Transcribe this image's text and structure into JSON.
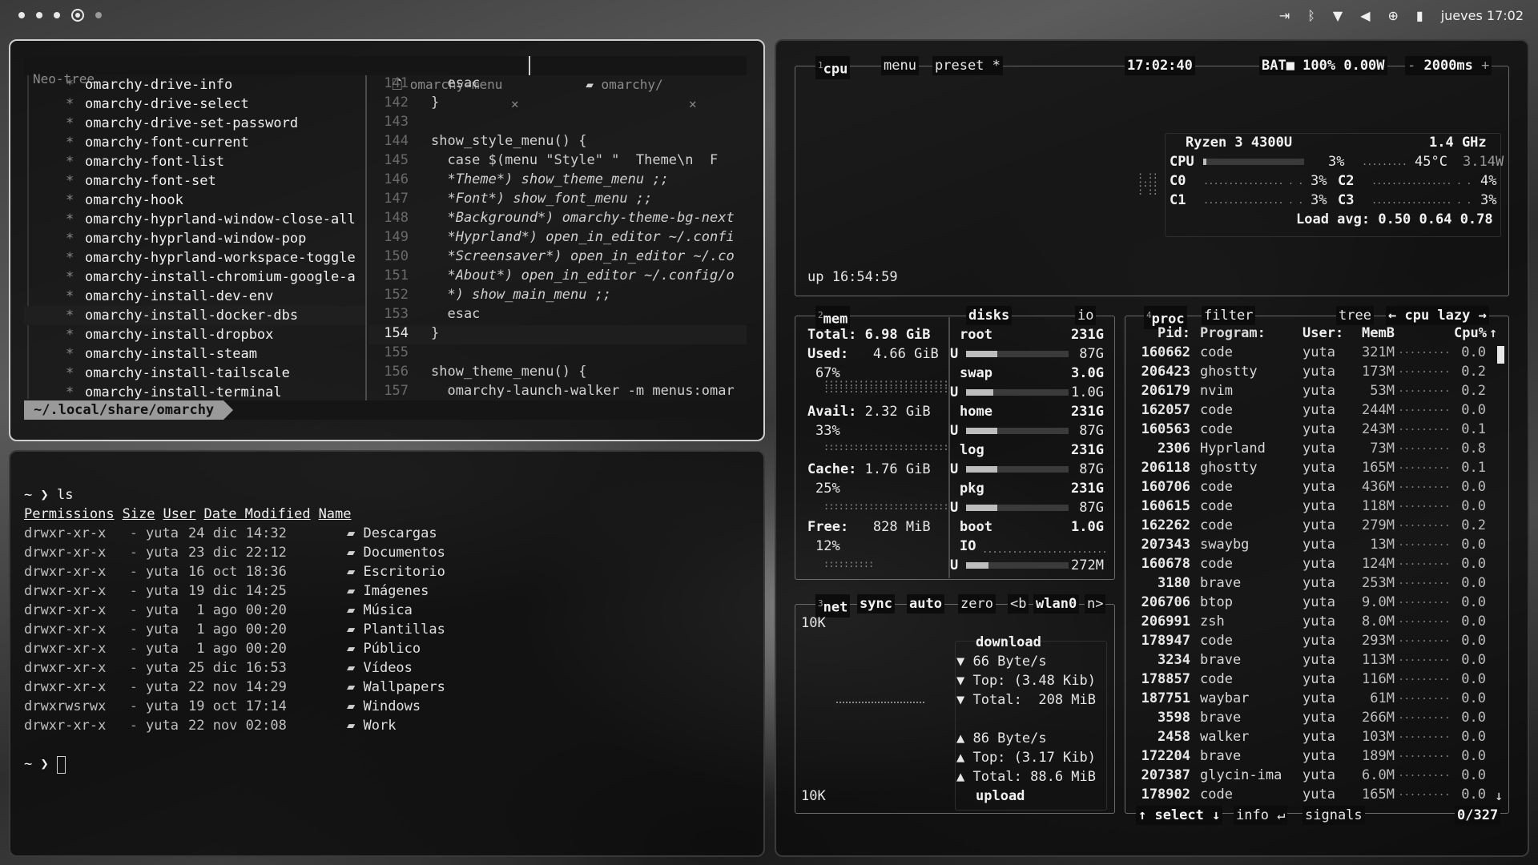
{
  "topbar": {
    "clock": "jueves 17:02",
    "workspaces": [
      "1",
      "2",
      "3",
      "4",
      "5"
    ],
    "active_workspace": 3
  },
  "nvim": {
    "tree_title": "Neo-tree",
    "tabs": [
      {
        "icon": "file-icon",
        "label": "omarchy-menu"
      },
      {
        "icon": "folder-icon",
        "label": "omarchy/"
      }
    ],
    "tree": [
      "omarchy-drive-info",
      "omarchy-drive-select",
      "omarchy-drive-set-password",
      "omarchy-font-current",
      "omarchy-font-list",
      "omarchy-font-set",
      "omarchy-hook",
      "omarchy-hyprland-window-close-all",
      "omarchy-hyprland-window-pop",
      "omarchy-hyprland-workspace-toggle",
      "omarchy-install-chromium-google-a",
      "omarchy-install-dev-env",
      "omarchy-install-docker-dbs",
      "omarchy-install-dropbox",
      "omarchy-install-steam",
      "omarchy-install-tailscale",
      "omarchy-install-terminal"
    ],
    "tree_selected": 12,
    "code": [
      {
        "ln": "141",
        "text": "  esac"
      },
      {
        "ln": "142",
        "text": "}"
      },
      {
        "ln": "143",
        "text": ""
      },
      {
        "ln": "144",
        "text": "show_style_menu() {"
      },
      {
        "ln": "145",
        "text": "  case $(menu \"Style\" \"  Theme\\n  F"
      },
      {
        "ln": "146",
        "text": "  *Theme*) show_theme_menu ;;"
      },
      {
        "ln": "147",
        "text": "  *Font*) show_font_menu ;;"
      },
      {
        "ln": "148",
        "text": "  *Background*) omarchy-theme-bg-next"
      },
      {
        "ln": "149",
        "text": "  *Hyprland*) open_in_editor ~/.confi"
      },
      {
        "ln": "150",
        "text": "  *Screensaver*) open_in_editor ~/.co"
      },
      {
        "ln": "151",
        "text": "  *About*) open_in_editor ~/.config/o"
      },
      {
        "ln": "152",
        "text": "  *) show_main_menu ;;"
      },
      {
        "ln": "153",
        "text": "  esac"
      },
      {
        "ln": "154",
        "text": "}"
      },
      {
        "ln": "155",
        "text": ""
      },
      {
        "ln": "156",
        "text": "show_theme_menu() {"
      },
      {
        "ln": "157",
        "text": "  omarchy-launch-walker -m menus:omar"
      }
    ],
    "current_line": 13,
    "path": "~/.local/share/omarchy"
  },
  "terminal": {
    "prompt": "~ ❯",
    "command": "ls",
    "headers": [
      "Permissions",
      "Size",
      "User",
      "Date Modified",
      "Name"
    ],
    "rows": [
      {
        "perm": "drwxr-xr-x",
        "size": "-",
        "user": "yuta",
        "date": "24 dic 14:32",
        "name": "Descargas"
      },
      {
        "perm": "drwxr-xr-x",
        "size": "-",
        "user": "yuta",
        "date": "23 dic 22:12",
        "name": "Documentos"
      },
      {
        "perm": "drwxr-xr-x",
        "size": "-",
        "user": "yuta",
        "date": "16 oct 18:36",
        "name": "Escritorio"
      },
      {
        "perm": "drwxr-xr-x",
        "size": "-",
        "user": "yuta",
        "date": "19 dic 14:25",
        "name": "Imágenes"
      },
      {
        "perm": "drwxr-xr-x",
        "size": "-",
        "user": "yuta",
        "date": " 1 ago 00:20",
        "name": "Música"
      },
      {
        "perm": "drwxr-xr-x",
        "size": "-",
        "user": "yuta",
        "date": " 1 ago 00:20",
        "name": "Plantillas"
      },
      {
        "perm": "drwxr-xr-x",
        "size": "-",
        "user": "yuta",
        "date": " 1 ago 00:20",
        "name": "Público"
      },
      {
        "perm": "drwxr-xr-x",
        "size": "-",
        "user": "yuta",
        "date": "25 dic 16:53",
        "name": "Vídeos"
      },
      {
        "perm": "drwxr-xr-x",
        "size": "-",
        "user": "yuta",
        "date": "22 nov 14:29",
        "name": "Wallpapers"
      },
      {
        "perm": "drwxrwsrwx",
        "size": "-",
        "user": "yuta",
        "date": "19 oct 17:14",
        "name": "Windows"
      },
      {
        "perm": "drwxr-xr-x",
        "size": "-",
        "user": "yuta",
        "date": "22 nov 02:08",
        "name": "Work"
      }
    ]
  },
  "btop": {
    "cpu_box": {
      "num": "1",
      "title": "cpu",
      "menu": "menu",
      "preset": "preset *",
      "time": "17:02:40",
      "battery": "BAT■ 100% 0.00W",
      "interval": "2000ms"
    },
    "cpu_info": {
      "model": "Ryzen 3 4300U",
      "freq": "1.4 GHz",
      "cpu_label": "CPU",
      "cpu_pct": "3%",
      "cpu_pct_val": 3,
      "temp": "45°C",
      "power": "3.14W",
      "cores": [
        {
          "label": "C0",
          "pct": "3%"
        },
        {
          "label": "C2",
          "pct": "4%"
        },
        {
          "label": "C1",
          "pct": "3%"
        },
        {
          "label": "C3",
          "pct": "3%"
        }
      ],
      "load_avg": "Load avg: 0.50 0.64 0.78"
    },
    "uptime": "up 16:54:59",
    "mem": {
      "num": "2",
      "title": "mem",
      "disks_title": "disks",
      "io_title": "io",
      "total": "Total: 6.98 GiB",
      "used_label": "Used:",
      "used": "4.66 GiB",
      "used_pct": "67%",
      "avail_label": "Avail:",
      "avail": "2.32 GiB",
      "avail_pct": "33%",
      "cache_label": "Cache:",
      "cache": "1.76 GiB",
      "cache_pct": "25%",
      "free_label": "Free:",
      "free": "828 MiB",
      "free_pct": "12%"
    },
    "disks": [
      {
        "name": "root",
        "size": "231G",
        "used": "87G",
        "fill": 0.38
      },
      {
        "name": "swap",
        "size": "3.0G",
        "used": "1.0G",
        "fill": 0.33
      },
      {
        "name": "home",
        "size": "231G",
        "used": "87G",
        "fill": 0.38
      },
      {
        "name": "log",
        "size": "231G",
        "used": "87G",
        "fill": 0.38
      },
      {
        "name": "pkg",
        "size": "231G",
        "used": "87G",
        "fill": 0.38
      },
      {
        "name": "boot",
        "size": "1.0G",
        "used": "272M",
        "fill": 0.27
      }
    ],
    "disk_io_label": "IO",
    "net": {
      "num": "3",
      "title": "net",
      "sync": "sync",
      "auto": "auto",
      "zero": "zero",
      "iface_prev": "<b",
      "iface": "wlan0",
      "iface_next": "n>",
      "scale_top": "10K",
      "scale_bottom": "10K",
      "download": "download",
      "dl_rate": "▼ 66 Byte/s",
      "dl_top": "▼ Top: (3.48 Kib)",
      "dl_total": "▼ Total:  208 MiB",
      "ul_rate": "▲ 86 Byte/s",
      "ul_top": "▲ Top: (3.17 Kib)",
      "ul_total": "▲ Total: 88.6 MiB",
      "upload": "upload"
    },
    "proc": {
      "num": "4",
      "title": "proc",
      "filter": "filter",
      "tree": "tree",
      "sort": "← cpu lazy →",
      "headers": {
        "pid": "Pid:",
        "program": "Program:",
        "user": "User:",
        "mem": "MemB",
        "cpu": "Cpu%"
      },
      "rows": [
        {
          "pid": "160662",
          "program": "code",
          "user": "yuta",
          "mem": "321M",
          "cpu": "0.0"
        },
        {
          "pid": "206423",
          "program": "ghostty",
          "user": "yuta",
          "mem": "173M",
          "cpu": "0.2"
        },
        {
          "pid": "206179",
          "program": "nvim",
          "user": "yuta",
          "mem": "53M",
          "cpu": "0.2"
        },
        {
          "pid": "162057",
          "program": "code",
          "user": "yuta",
          "mem": "244M",
          "cpu": "0.0"
        },
        {
          "pid": "160563",
          "program": "code",
          "user": "yuta",
          "mem": "243M",
          "cpu": "0.1"
        },
        {
          "pid": "2306",
          "program": "Hyprland",
          "user": "yuta",
          "mem": "73M",
          "cpu": "0.8"
        },
        {
          "pid": "206118",
          "program": "ghostty",
          "user": "yuta",
          "mem": "165M",
          "cpu": "0.1"
        },
        {
          "pid": "160706",
          "program": "code",
          "user": "yuta",
          "mem": "436M",
          "cpu": "0.0"
        },
        {
          "pid": "160615",
          "program": "code",
          "user": "yuta",
          "mem": "118M",
          "cpu": "0.0"
        },
        {
          "pid": "162262",
          "program": "code",
          "user": "yuta",
          "mem": "279M",
          "cpu": "0.2"
        },
        {
          "pid": "207343",
          "program": "swaybg",
          "user": "yuta",
          "mem": "13M",
          "cpu": "0.0"
        },
        {
          "pid": "160678",
          "program": "code",
          "user": "yuta",
          "mem": "124M",
          "cpu": "0.0"
        },
        {
          "pid": "3180",
          "program": "brave",
          "user": "yuta",
          "mem": "253M",
          "cpu": "0.0"
        },
        {
          "pid": "206706",
          "program": "btop",
          "user": "yuta",
          "mem": "9.0M",
          "cpu": "0.0"
        },
        {
          "pid": "206991",
          "program": "zsh",
          "user": "yuta",
          "mem": "8.0M",
          "cpu": "0.0"
        },
        {
          "pid": "178947",
          "program": "code",
          "user": "yuta",
          "mem": "293M",
          "cpu": "0.0"
        },
        {
          "pid": "3234",
          "program": "brave",
          "user": "yuta",
          "mem": "113M",
          "cpu": "0.0"
        },
        {
          "pid": "178857",
          "program": "code",
          "user": "yuta",
          "mem": "116M",
          "cpu": "0.0"
        },
        {
          "pid": "187751",
          "program": "waybar",
          "user": "yuta",
          "mem": "61M",
          "cpu": "0.0"
        },
        {
          "pid": "3598",
          "program": "brave",
          "user": "yuta",
          "mem": "266M",
          "cpu": "0.0"
        },
        {
          "pid": "2458",
          "program": "walker",
          "user": "yuta",
          "mem": "103M",
          "cpu": "0.0"
        },
        {
          "pid": "172204",
          "program": "brave",
          "user": "yuta",
          "mem": "189M",
          "cpu": "0.0"
        },
        {
          "pid": "207387",
          "program": "glycin-ima",
          "user": "yuta",
          "mem": "6.0M",
          "cpu": "0.0"
        },
        {
          "pid": "178902",
          "program": "code",
          "user": "yuta",
          "mem": "165M",
          "cpu": "0.0"
        }
      ],
      "footer_select": "↑ select ↓",
      "footer_info": "info ↵",
      "footer_signals": "signals",
      "count": "0/327"
    }
  }
}
